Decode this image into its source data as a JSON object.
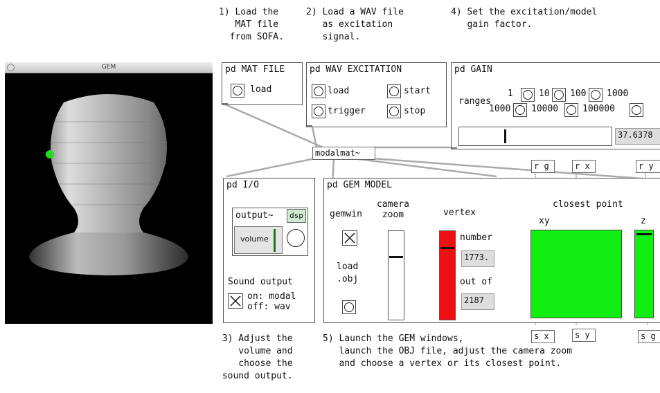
{
  "notes": {
    "step1": "1) Load the\n   MAT file\n  from SOFA.",
    "step2": "2) Load a WAV file\n   as excitation\n   signal.",
    "step4": "4) Set the excitation/model\n   gain factor.",
    "step3": "3) Adjust the\n    volume and\n    choose the\nsound output.",
    "step5": "5) Launch the GEM windows,\n   launch the OBJ file, adjust the camera zoom\n   and choose a vertex or its closest point."
  },
  "gem_window": {
    "title": "GEM"
  },
  "mat_file": {
    "title": "pd MAT FILE",
    "load": "load"
  },
  "wav": {
    "title": "pd WAV EXCITATION",
    "load": "load",
    "start": "start",
    "trigger": "trigger",
    "stop": "stop"
  },
  "gain": {
    "title": "pd GAIN",
    "ranges": "ranges",
    "r1": "1",
    "r10": "10",
    "r100": "100",
    "r1000a": "1000",
    "r1000b": "1000",
    "r10000": "10000",
    "r100000": "100000",
    "slider_value": 0.3,
    "value": "37.6378"
  },
  "modal": {
    "label": "modalmat~"
  },
  "receivers": {
    "rg": "r g",
    "rx": "r x",
    "ry": "r y"
  },
  "senders": {
    "sx": "s x",
    "sy": "s y",
    "sg": "s g"
  },
  "io": {
    "title": "pd I/O",
    "output": "output~",
    "dsp": "dsp",
    "volume": "volume",
    "sound_output": "Sound output",
    "on": "on: modal",
    "off": "off: wav"
  },
  "gem_model": {
    "title": "pd GEM MODEL",
    "gemwin": "gemwin",
    "camera_zoom": "camera\nzoom",
    "load_obj": "load\n.obj",
    "vertex": "vertex",
    "number_label": "number",
    "number_value": "1773.",
    "out_of_label": "out of",
    "out_of_value": "2187",
    "closest_point": "closest point",
    "xy": "xy",
    "z": "z",
    "zoom_level": 0.7,
    "vertex_level": 0.81,
    "z_level": 0.97
  },
  "colors": {
    "green": "#11ee11",
    "red": "#ee1111",
    "background": "#ffffff",
    "gem_background": "#000000"
  }
}
